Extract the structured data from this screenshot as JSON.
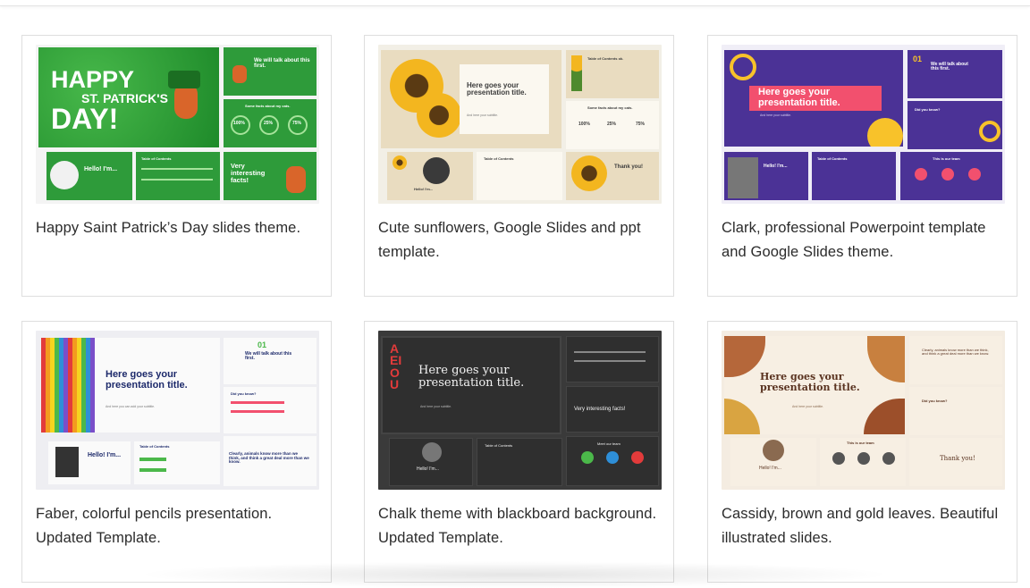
{
  "cards": [
    {
      "caption": "Happy Saint Patrick’s Day slides theme.",
      "thumb": {
        "title_line1": "HAPPY",
        "title_line2": "ST. PATRICK'S",
        "title_line3": "DAY!",
        "s2": "We will talk about this first.",
        "s3": "Some facts about my cats.",
        "s4": "Hello! I'm...",
        "s5": "Table of Contents",
        "s6": "Very interesting facts!",
        "pct1": "100%",
        "pct2": "25%",
        "pct3": "75%"
      }
    },
    {
      "caption": "Cute sunflowers, Google Slides and ppt template.",
      "thumb": {
        "title": "Here goes your presentation title.",
        "subtitle": "And here your subtitle.",
        "s2": "Table of Contents ok.",
        "s3": "Some facts about my cats.",
        "pct1": "100%",
        "pct2": "25%",
        "pct3": "75%",
        "s4": "Hello! I'm...",
        "s5": "Table of Contents",
        "s6": "Thank you!"
      }
    },
    {
      "caption": "Clark, professional Powerpoint template and Google Slides theme.",
      "thumb": {
        "title": "Here goes your presentation title.",
        "subtitle": "And here your subtitle.",
        "num": "01",
        "s2": "We will talk about this first.",
        "s3": "Did you know?",
        "s4": "Hello! I'm...",
        "s5": "Table of Contents",
        "s6": "This is our team"
      }
    },
    {
      "caption": "Faber, colorful pencils presentation. Updated Template.",
      "thumb": {
        "title": "Here goes your presentation title.",
        "subtitle": "And here you can add your subtitle.",
        "num": "01",
        "s2": "We will talk about this first.",
        "s3": "Did you know?",
        "s4": "Hello! I'm...",
        "s5": "Table of Contents",
        "s6": "Clearly, animals know more than we think, and think a great deal more than we know."
      }
    },
    {
      "caption": "Chalk theme with blackboard background. Updated Template.",
      "thumb": {
        "title": "Here goes your presentation title.",
        "subtitle": "And here your subtitle.",
        "letters": "AEIOU",
        "s3": "Very interesting facts!",
        "s4": "Hello! I'm...",
        "s5": "Table of Contents",
        "s6": "Meet our team"
      }
    },
    {
      "caption": "Cassidy, brown and gold leaves. Beautiful illustrated slides.",
      "thumb": {
        "title": "Here goes your presentation title.",
        "subtitle": "And here your subtitle.",
        "s2": "Clearly, animals know more than we think, and think a great deal more than we know.",
        "s3": "Did you know?",
        "s4": "Hello! I'm...",
        "s5": "This is our team",
        "s6": "Thank you!"
      }
    }
  ],
  "colors": {
    "accent_green": "#2e9b3a",
    "sun_beige": "#e9dcc0",
    "clark_purple": "#4b3296",
    "clark_pink": "#f2506e",
    "faber_navy": "#1d2a6b",
    "chalk_dark": "#2f2f2f",
    "cassidy_brown": "#b5673a"
  }
}
